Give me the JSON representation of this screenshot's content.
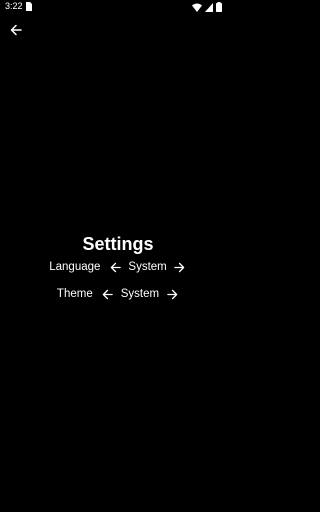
{
  "status_bar": {
    "time": "3:22",
    "icons": [
      "sim-icon",
      "wifi-icon",
      "signal-icon",
      "battery-icon"
    ]
  },
  "header": {
    "back_icon": "arrow-left-icon"
  },
  "settings": {
    "title": "Settings",
    "rows": [
      {
        "label": "Language",
        "value": "System",
        "prev_icon": "arrow-left-icon",
        "next_icon": "arrow-right-icon"
      },
      {
        "label": "Theme",
        "value": "System",
        "prev_icon": "arrow-left-icon",
        "next_icon": "arrow-right-icon"
      }
    ]
  },
  "colors": {
    "background": "#000000",
    "foreground": "#ffffff"
  }
}
